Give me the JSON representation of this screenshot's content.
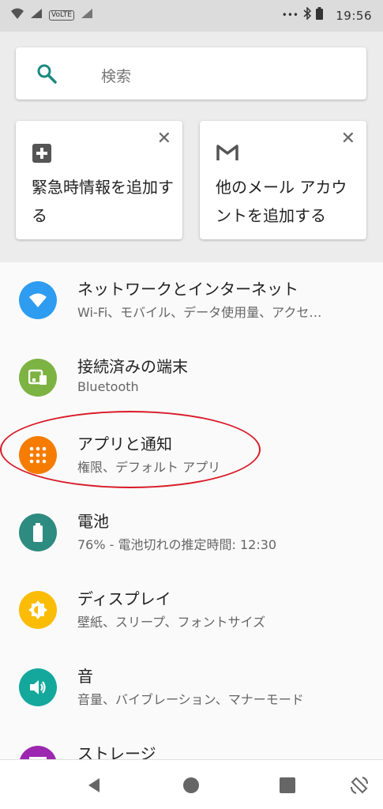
{
  "status_bar": {
    "time": "19:56",
    "icons": [
      "signal-icon",
      "wifi-icon",
      "volte-icon",
      "mobile-data-icon",
      "more-icon",
      "bluetooth-icon",
      "battery-icon"
    ]
  },
  "search": {
    "placeholder": "検索",
    "icon": "search-icon"
  },
  "suggestions": [
    {
      "icon": "plus-square-icon",
      "text": "緊急時情報を追加する"
    },
    {
      "icon": "gmail-icon",
      "text": "他のメール アカウントを追加する"
    }
  ],
  "settings": [
    {
      "title": "ネットワークとインターネット",
      "subtitle": "Wi-Fi、モバイル、データ使用量、アクセ…",
      "icon": "wifi-icon",
      "color": "#2e9cf0"
    },
    {
      "title": "接続済みの端末",
      "subtitle": "Bluetooth",
      "icon": "devices-icon",
      "color": "#7cb342"
    },
    {
      "title": "アプリと通知",
      "subtitle": "権限、デフォルト アプリ",
      "icon": "apps-grid-icon",
      "color": "#f57c00"
    },
    {
      "title": "電池",
      "subtitle": "76% - 電池切れの推定時間: 12:30",
      "icon": "battery-icon",
      "color": "#2e8b7f"
    },
    {
      "title": "ディスプレイ",
      "subtitle": "壁紙、スリープ、フォントサイズ",
      "icon": "brightness-icon",
      "color": "#fbbc05"
    },
    {
      "title": "音",
      "subtitle": "音量、バイブレーション、マナーモード",
      "icon": "volume-icon",
      "color": "#14a89d"
    },
    {
      "title": "ストレージ",
      "subtitle": "",
      "icon": "storage-icon",
      "color": "#9c27b0"
    }
  ],
  "annotation_color": "#d81b28",
  "nav": {
    "back_icon": "back-icon",
    "home_icon": "home-icon",
    "recents_icon": "recents-icon",
    "rotate_icon": "rotate-icon"
  }
}
